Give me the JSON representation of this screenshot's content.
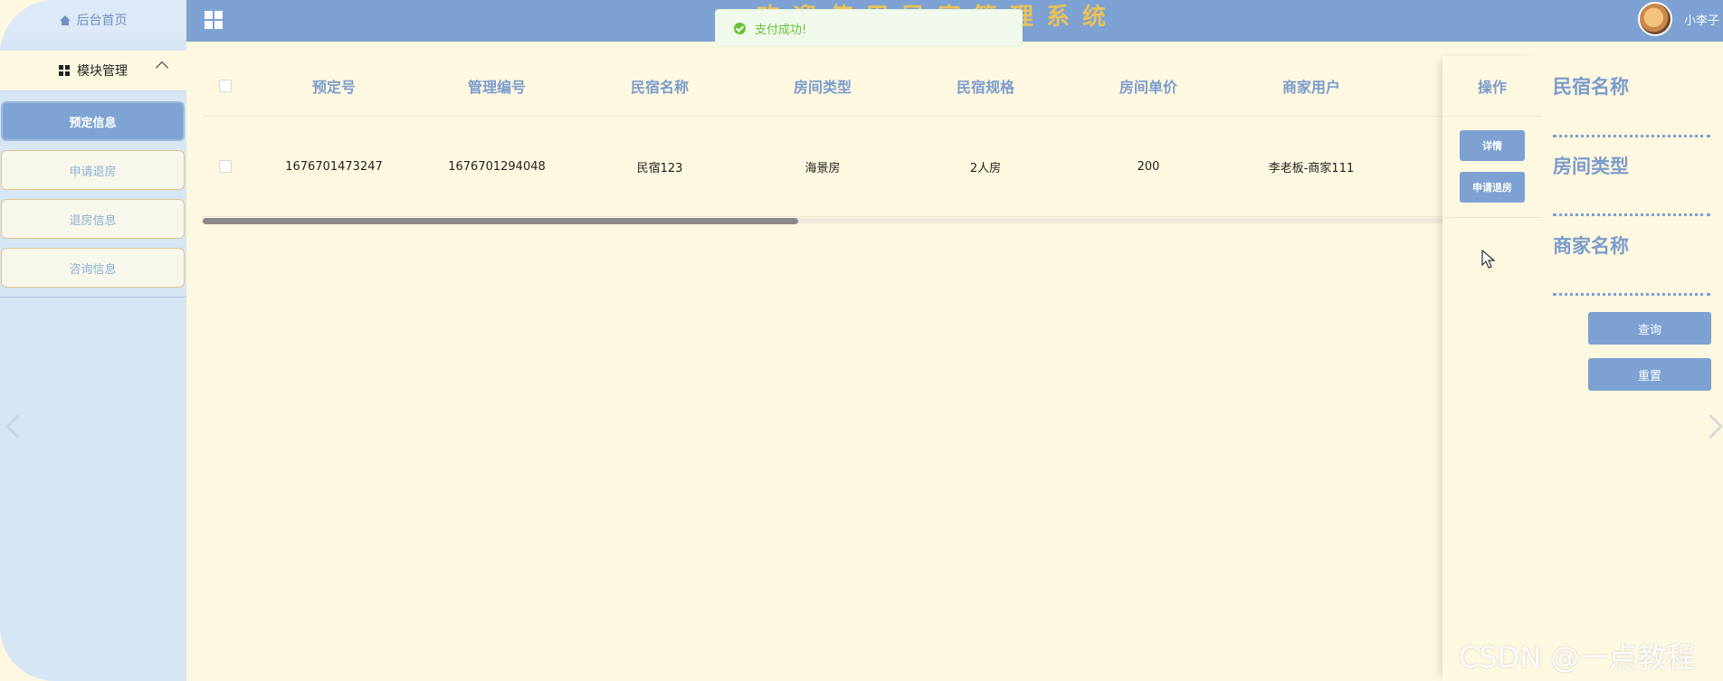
{
  "sidebar": {
    "home": "后台首页",
    "module": "模块管理",
    "items": [
      "预定信息",
      "申请退房",
      "退房信息",
      "咨询信息"
    ]
  },
  "header": {
    "title": "欢迎使用民宿管理系统",
    "username": "小李子"
  },
  "toast": {
    "message": "支付成功!"
  },
  "table": {
    "columns": [
      "预定号",
      "管理编号",
      "民宿名称",
      "房间类型",
      "民宿规格",
      "房间单价",
      "商家用户"
    ],
    "operation_header": "操作",
    "rows": [
      [
        "1676701473247",
        "1676701294048",
        "民宿123",
        "海景房",
        "2人房",
        "200",
        "李老板-商家111"
      ]
    ],
    "row_actions": [
      "详情",
      "申请退房"
    ]
  },
  "search": {
    "labels": [
      "民宿名称",
      "房间类型",
      "商家名称"
    ],
    "query_button": "查询",
    "reset_button": "重置"
  },
  "watermark": "CSDN @一点教程",
  "colors": {
    "primary": "#7ca1d2",
    "title": "#e8c15a",
    "background": "#fff8e1",
    "success": "#67c23a"
  }
}
